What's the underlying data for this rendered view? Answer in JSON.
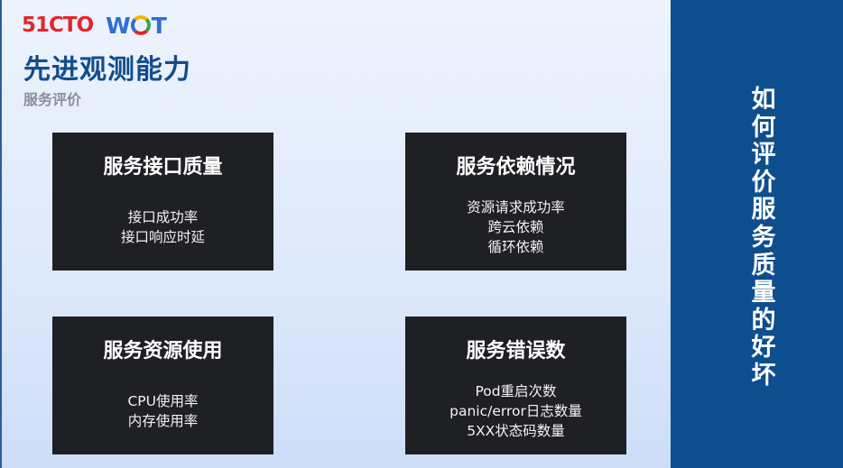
{
  "logo": {
    "brand_a": "51CTO",
    "brand_b_left": "W",
    "brand_b_right": "T"
  },
  "header": {
    "title": "先进观测能力",
    "subtitle": "服务评价"
  },
  "cards": [
    {
      "title": "服务接口质量",
      "items": [
        "接口成功率",
        "接口响应时延"
      ]
    },
    {
      "title": "服务依赖情况",
      "items": [
        "资源请求成功率",
        "跨云依赖",
        "循环依赖"
      ]
    },
    {
      "title": "服务资源使用",
      "items": [
        "CPU使用率",
        "内存使用率"
      ]
    },
    {
      "title": "服务错误数",
      "items": [
        "Pod重启次数",
        "panic/error日志数量",
        "5XX状态码数量"
      ]
    }
  ],
  "sidebar": {
    "text": "如何评价服务质量的好坏"
  },
  "colors": {
    "sidebar_bg": "#0d4e8e",
    "card_bg": "#1f2024",
    "title": "#124d8c",
    "logo_red": "#e3262c",
    "logo_blue": "#2e6fd2"
  }
}
